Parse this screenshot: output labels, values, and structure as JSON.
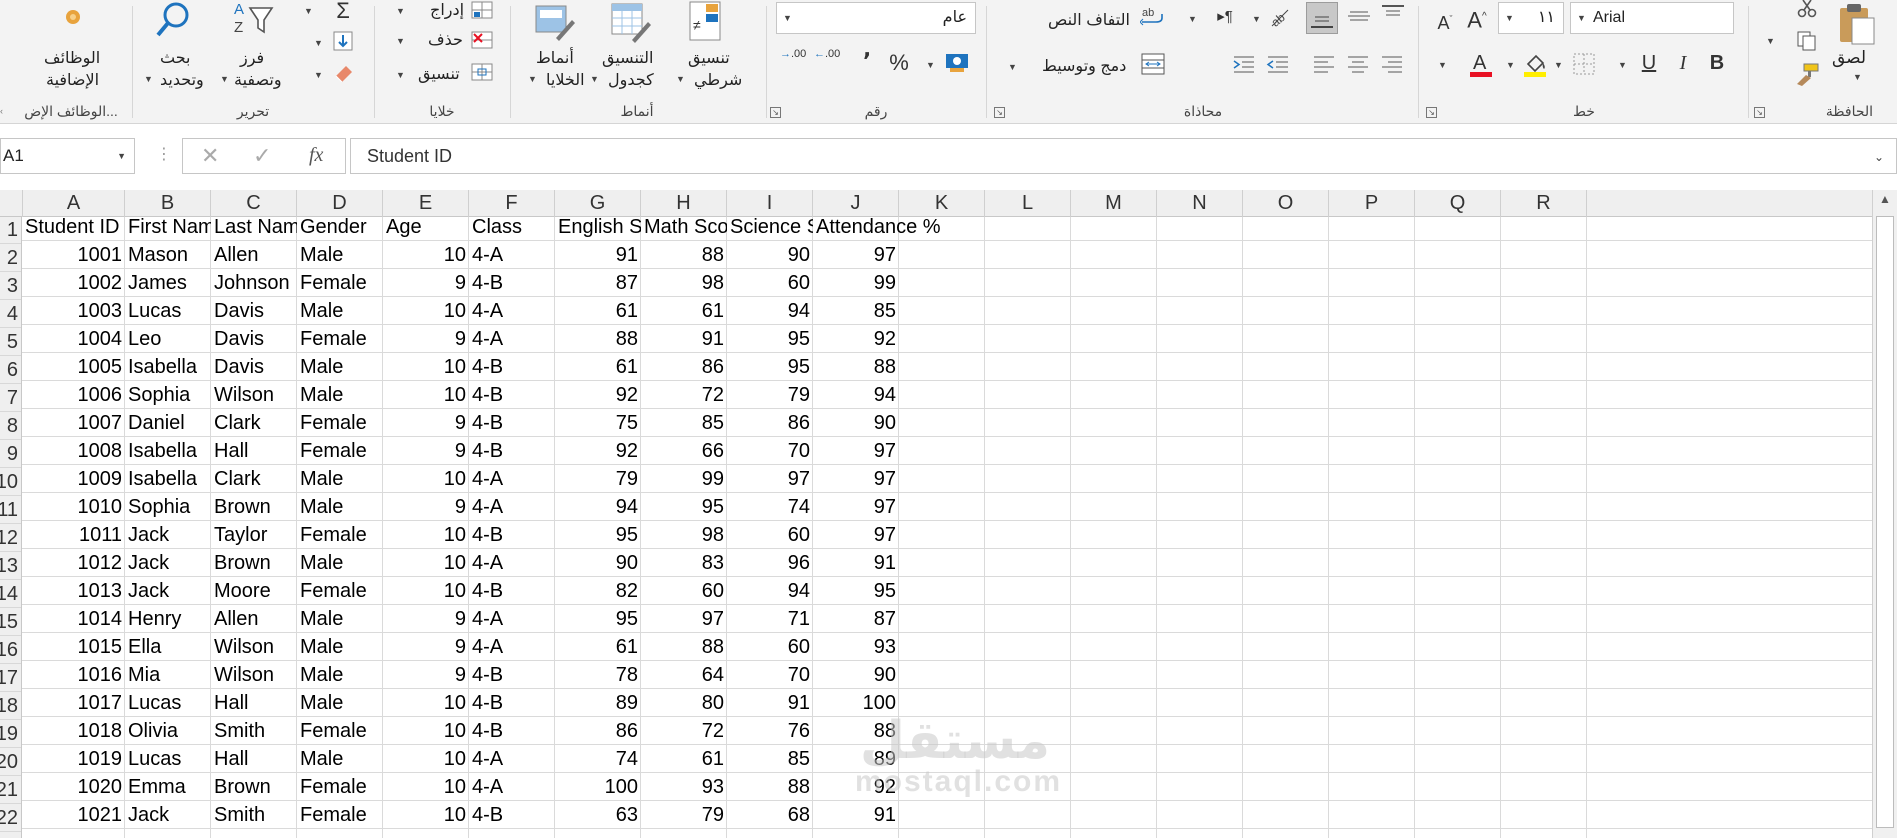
{
  "ribbon": {
    "clipboard": {
      "group_label": "الحافظة",
      "paste_label": "لصق"
    },
    "font": {
      "group_label": "خط",
      "font_name": "Arial",
      "font_size": "١١",
      "bold_label": "B",
      "italic_label": "I",
      "underline_label": "U",
      "grow_label": "A",
      "shrink_label": "A"
    },
    "alignment": {
      "group_label": "محاذاة",
      "wrap_text_label": "التفاف النص",
      "merge_center_label": "دمج وتوسيط"
    },
    "number": {
      "group_label": "رقم",
      "format_value": "عام",
      "percent_label": "%",
      "comma_label": "٬",
      "inc_decimal_label": ".00",
      "dec_decimal_label": ".00"
    },
    "styles": {
      "group_label": "أنماط",
      "conditional_label_1": "تنسيق",
      "conditional_label_2": "شرطي",
      "table_label_1": "التنسيق",
      "table_label_2": "كجدول",
      "cell_styles_label_1": "أنماط",
      "cell_styles_label_2": "الخلايا"
    },
    "cells": {
      "group_label": "خلايا",
      "insert_label": "إدراج",
      "delete_label": "حذف",
      "format_label": "تنسيق"
    },
    "editing": {
      "group_label": "تحرير",
      "sort_label_1": "فرز",
      "sort_label_2": "وتصفية",
      "find_label_1": "بحث",
      "find_label_2": "وتحديد",
      "sigma_label": "Σ"
    },
    "addins": {
      "group_label": "الوظائف الإض...",
      "label_1": "الوظائف",
      "label_2": "الإضافية"
    }
  },
  "formula_bar": {
    "name_box": "A1",
    "formula": "Student ID",
    "fx_label": "fx"
  },
  "columns": [
    "A",
    "B",
    "C",
    "D",
    "E",
    "F",
    "G",
    "H",
    "I",
    "J",
    "K",
    "L",
    "M",
    "N",
    "O",
    "P",
    "Q",
    "R"
  ],
  "rows": [
    1,
    2,
    3,
    4,
    5,
    6,
    7,
    8,
    9,
    10,
    11,
    12,
    13,
    14,
    15,
    16,
    17,
    18,
    19,
    20,
    21,
    22
  ],
  "header_row": [
    "Student ID",
    "First Name",
    "Last Name",
    "Gender",
    "Age",
    "Class",
    "English Score",
    "Math Score",
    "Science Score",
    "Attendance %"
  ],
  "data_rows": [
    [
      "1001",
      "Mason",
      "Allen",
      "Male",
      "10",
      "4-A",
      "91",
      "88",
      "90",
      "97"
    ],
    [
      "1002",
      "James",
      "Johnson",
      "Female",
      "9",
      "4-B",
      "87",
      "98",
      "60",
      "99"
    ],
    [
      "1003",
      "Lucas",
      "Davis",
      "Male",
      "10",
      "4-A",
      "61",
      "61",
      "94",
      "85"
    ],
    [
      "1004",
      "Leo",
      "Davis",
      "Female",
      "9",
      "4-A",
      "88",
      "91",
      "95",
      "92"
    ],
    [
      "1005",
      "Isabella",
      "Davis",
      "Male",
      "10",
      "4-B",
      "61",
      "86",
      "95",
      "88"
    ],
    [
      "1006",
      "Sophia",
      "Wilson",
      "Male",
      "10",
      "4-B",
      "92",
      "72",
      "79",
      "94"
    ],
    [
      "1007",
      "Daniel",
      "Clark",
      "Female",
      "9",
      "4-B",
      "75",
      "85",
      "86",
      "90"
    ],
    [
      "1008",
      "Isabella",
      "Hall",
      "Female",
      "9",
      "4-B",
      "92",
      "66",
      "70",
      "97"
    ],
    [
      "1009",
      "Isabella",
      "Clark",
      "Male",
      "10",
      "4-A",
      "79",
      "99",
      "97",
      "97"
    ],
    [
      "1010",
      "Sophia",
      "Brown",
      "Male",
      "9",
      "4-A",
      "94",
      "95",
      "74",
      "97"
    ],
    [
      "1011",
      "Jack",
      "Taylor",
      "Female",
      "10",
      "4-B",
      "95",
      "98",
      "60",
      "97"
    ],
    [
      "1012",
      "Jack",
      "Brown",
      "Male",
      "10",
      "4-A",
      "90",
      "83",
      "96",
      "91"
    ],
    [
      "1013",
      "Jack",
      "Moore",
      "Female",
      "10",
      "4-B",
      "82",
      "60",
      "94",
      "95"
    ],
    [
      "1014",
      "Henry",
      "Allen",
      "Male",
      "9",
      "4-A",
      "95",
      "97",
      "71",
      "87"
    ],
    [
      "1015",
      "Ella",
      "Wilson",
      "Male",
      "9",
      "4-A",
      "61",
      "88",
      "60",
      "93"
    ],
    [
      "1016",
      "Mia",
      "Wilson",
      "Male",
      "9",
      "4-B",
      "78",
      "64",
      "70",
      "90"
    ],
    [
      "1017",
      "Lucas",
      "Hall",
      "Male",
      "10",
      "4-B",
      "89",
      "80",
      "91",
      "100"
    ],
    [
      "1018",
      "Olivia",
      "Smith",
      "Female",
      "10",
      "4-B",
      "86",
      "72",
      "76",
      "88"
    ],
    [
      "1019",
      "Lucas",
      "Hall",
      "Male",
      "10",
      "4-A",
      "74",
      "61",
      "85",
      "89"
    ],
    [
      "1020",
      "Emma",
      "Brown",
      "Female",
      "10",
      "4-A",
      "100",
      "93",
      "88",
      "92"
    ],
    [
      "1021",
      "Jack",
      "Smith",
      "Female",
      "10",
      "4-B",
      "63",
      "79",
      "68",
      "91"
    ]
  ],
  "numeric_columns": [
    0,
    4,
    6,
    7,
    8,
    9
  ],
  "watermark": {
    "line1": "مستقل",
    "line2": "mostaql.com"
  },
  "colors": {
    "font_color_bar": "#e81123",
    "highlight_bar": "#ffee00",
    "fill_blue": "#1e73be"
  }
}
